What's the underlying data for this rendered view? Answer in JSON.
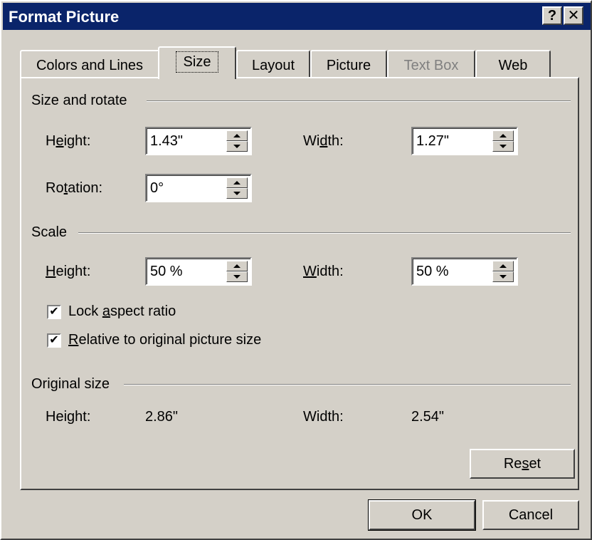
{
  "window": {
    "title": "Format Picture",
    "help_glyph": "?",
    "close_glyph": "✕"
  },
  "tabs": [
    {
      "label": "Colors and Lines",
      "state": "normal"
    },
    {
      "label": "Size",
      "state": "active"
    },
    {
      "label": "Layout",
      "state": "normal"
    },
    {
      "label": "Picture",
      "state": "normal"
    },
    {
      "label": "Text Box",
      "state": "disabled"
    },
    {
      "label": "Web",
      "state": "normal"
    }
  ],
  "size_rotate": {
    "header": "Size and rotate",
    "height_label_pre": "H",
    "height_label_ul": "e",
    "height_label_post": "ight:",
    "height_value": "1.43\"",
    "width_label_pre": "Wi",
    "width_label_ul": "d",
    "width_label_post": "th:",
    "width_value": "1.27\"",
    "rotation_label_pre": "Ro",
    "rotation_label_ul": "t",
    "rotation_label_post": "ation:",
    "rotation_value": "0°"
  },
  "scale": {
    "header": "Scale",
    "height_label_ul": "H",
    "height_label_post": "eight:",
    "height_value": "50 %",
    "width_label_ul": "W",
    "width_label_post": "idth:",
    "width_value": "50 %",
    "lock_aspect_pre": "Lock ",
    "lock_aspect_ul": "a",
    "lock_aspect_post": "spect ratio",
    "lock_aspect_checked": true,
    "relative_ul": "R",
    "relative_post": "elative to original picture size",
    "relative_checked": true,
    "check_glyph": "✔"
  },
  "original_size": {
    "header": "Original size",
    "height_label": "Height:",
    "height_value": "2.86\"",
    "width_label": "Width:",
    "width_value": "2.54\""
  },
  "buttons": {
    "reset_pre": "Re",
    "reset_ul": "s",
    "reset_post": "et",
    "ok": "OK",
    "cancel": "Cancel"
  }
}
